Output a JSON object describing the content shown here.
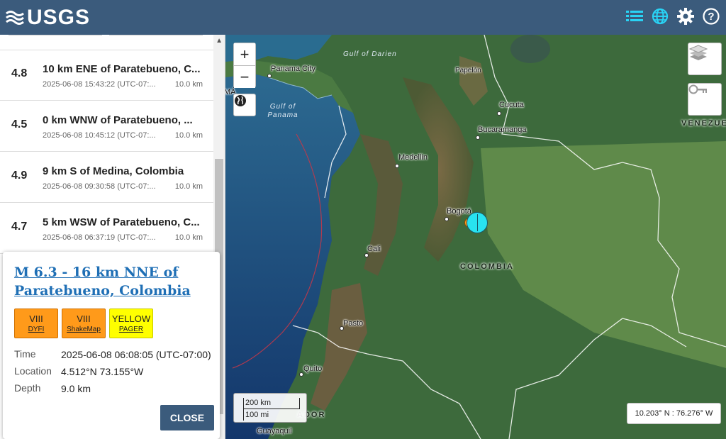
{
  "header": {
    "logo_text": "USGS",
    "icons": [
      "list-icon",
      "globe-icon",
      "gear-icon",
      "help-icon"
    ],
    "brand_color": "#3b5b7c",
    "accent_color": "#29d3f5"
  },
  "earthquakes": [
    {
      "mag": "4.8",
      "place": "10 km ENE of Paratebueno, C...",
      "time": "2025-06-08 15:43:22 (UTC-07:...",
      "depth": "10.0 km"
    },
    {
      "mag": "4.5",
      "place": "0 km WNW of Paratebueno, ...",
      "time": "2025-06-08 10:45:12 (UTC-07:...",
      "depth": "10.0 km"
    },
    {
      "mag": "4.9",
      "place": "9 km S of Medina, Colombia",
      "time": "2025-06-08 09:30:58 (UTC-07:...",
      "depth": "10.0 km"
    },
    {
      "mag": "4.7",
      "place": "5 km WSW of Paratebueno, C...",
      "time": "2025-06-08 06:37:19 (UTC-07:...",
      "depth": "10.0 km"
    }
  ],
  "map": {
    "cities": [
      "Panama City",
      "Cucuta",
      "Bucaramanga",
      "Medellin",
      "Bogotá",
      "Cali",
      "Pasto",
      "Quito",
      "Guayaquil",
      "Papelón"
    ],
    "water_labels": [
      "Gulf of Darien",
      "Gulf of Panama"
    ],
    "countries": [
      "COLOMBIA",
      "VENEZUE",
      "ADOR"
    ],
    "partial_label": "MÁ",
    "scale_km": "200 km",
    "scale_mi": "100 mi",
    "coordinates": "10.203° N : 76.276° W",
    "zoom_in": "+",
    "zoom_out": "−"
  },
  "popup": {
    "title": "M 6.3 - 16 km NNE of Paratebueno, Colombia",
    "badges": [
      {
        "value": "VIII",
        "label": "DYFI",
        "color": "#ff9a1a"
      },
      {
        "value": "VIII",
        "label": "ShakeMap",
        "color": "#ff9a1a"
      },
      {
        "value": "YELLOW",
        "label": "PAGER",
        "color": "#ffff00"
      }
    ],
    "details": {
      "time_label": "Time",
      "time": "2025-06-08 06:08:05 (UTC-07:00)",
      "location_label": "Location",
      "location": "4.512°N 73.155°W",
      "depth_label": "Depth",
      "depth": "9.0 km"
    },
    "close_label": "CLOSE"
  }
}
